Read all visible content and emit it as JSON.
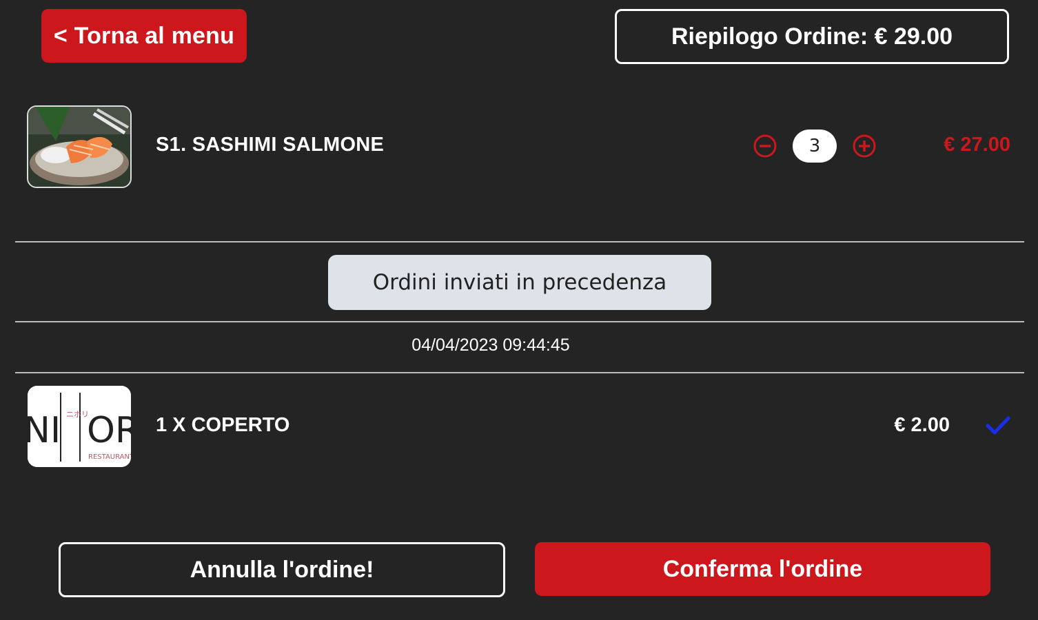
{
  "header": {
    "back_label": "< Torna al menu",
    "summary_label": "Riepilogo Ordine: € 29.00"
  },
  "cart_item": {
    "name": "S1. SASHIMI SALMONE",
    "quantity": "3",
    "price": "€ 27.00",
    "image_icon": "sashimi-photo"
  },
  "previous_orders": {
    "button_label": "Ordini inviati in precedenza",
    "date": "04/04/2023 09:44:45",
    "items": [
      {
        "name": "1 X COPERTO",
        "price": "€ 2.00",
        "logo_text": "NI OR",
        "logo_subtext": "RESTAURANT",
        "logo_kana": "ニホリ",
        "status_icon": "check-icon"
      }
    ]
  },
  "footer": {
    "cancel_label": "Annulla l'ordine!",
    "confirm_label": "Conferma l'ordine"
  },
  "colors": {
    "background": "#242424",
    "accent_red": "#cc171d",
    "secondary_button": "#dde3e8",
    "check_blue": "#1a2ee8"
  }
}
